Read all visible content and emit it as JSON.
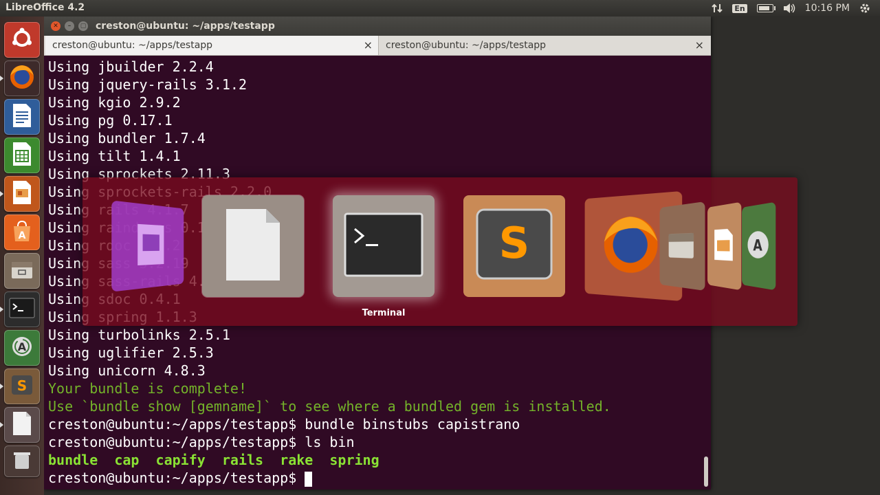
{
  "top_panel": {
    "app_title": "LibreOffice 4.2",
    "keyboard": "En",
    "clock": "10:16 PM"
  },
  "launcher": {
    "items": [
      {
        "icon": "ubuntu-dash-icon"
      },
      {
        "icon": "firefox-icon"
      },
      {
        "icon": "libreoffice-writer-icon"
      },
      {
        "icon": "libreoffice-calc-icon"
      },
      {
        "icon": "libreoffice-impress-icon"
      },
      {
        "icon": "ubuntu-software-center-icon"
      },
      {
        "icon": "files-icon"
      },
      {
        "icon": "terminal-icon"
      },
      {
        "icon": "software-updater-icon"
      },
      {
        "icon": "sublime-text-icon"
      },
      {
        "icon": "libreoffice-icon"
      },
      {
        "icon": "trash-icon"
      }
    ]
  },
  "window": {
    "title": "creston@ubuntu: ~/apps/testapp",
    "tabs": [
      {
        "label": "creston@ubuntu: ~/apps/testapp"
      },
      {
        "label": "creston@ubuntu: ~/apps/testapp"
      }
    ],
    "close_glyph": "×"
  },
  "terminal": {
    "lines": [
      {
        "text": "Using jbuilder 2.2.4",
        "style": "plain"
      },
      {
        "text": "Using jquery-rails 3.1.2",
        "style": "plain"
      },
      {
        "text": "Using kgio 2.9.2",
        "style": "plain"
      },
      {
        "text": "Using pg 0.17.1",
        "style": "plain"
      },
      {
        "text": "Using bundler 1.7.4",
        "style": "plain"
      },
      {
        "text": "Using tilt 1.4.1",
        "style": "plain"
      },
      {
        "text": "Using sprockets 2.11.3",
        "style": "plain"
      },
      {
        "text": "Using sprockets-rails 2.2.0",
        "style": "plain"
      },
      {
        "text": "Using rails 4.1.7",
        "style": "plain"
      },
      {
        "text": "Using raindrops 0.13.0",
        "style": "plain"
      },
      {
        "text": "Using rdoc 4.1.2",
        "style": "plain"
      },
      {
        "text": "Using sass 3.2.19",
        "style": "plain"
      },
      {
        "text": "Using sass-rails 4.0.4",
        "style": "plain"
      },
      {
        "text": "Using sdoc 0.4.1",
        "style": "plain"
      },
      {
        "text": "Using spring 1.1.3",
        "style": "plain"
      },
      {
        "text": "Using turbolinks 2.5.1",
        "style": "plain"
      },
      {
        "text": "Using uglifier 2.5.3",
        "style": "plain"
      },
      {
        "text": "Using unicorn 4.8.3",
        "style": "plain"
      },
      {
        "text": "Your bundle is complete!",
        "style": "green"
      },
      {
        "text": "Use `bundle show [gemname]` to see where a bundled gem is installed.",
        "style": "green"
      },
      {
        "text": "creston@ubuntu:~/apps/testapp$ bundle binstubs capistrano",
        "style": "plain"
      },
      {
        "text": "creston@ubuntu:~/apps/testapp$ ls bin",
        "style": "plain"
      },
      {
        "text": "bundle  cap  capify  rails  rake  spring",
        "style": "bold-green"
      },
      {
        "text": "creston@ubuntu:~/apps/testapp$ ",
        "style": "prompt"
      }
    ]
  },
  "switcher": {
    "selected_label": "Terminal",
    "items": [
      {
        "icon": "libreoffice-impress-icon"
      },
      {
        "icon": "libreoffice-icon"
      },
      {
        "icon": "terminal-icon"
      },
      {
        "icon": "sublime-text-icon"
      },
      {
        "icon": "firefox-icon"
      },
      {
        "icon": "files-icon"
      },
      {
        "icon": "libreoffice-impress-icon"
      },
      {
        "icon": "software-updater-icon"
      }
    ]
  },
  "colors": {
    "terminal_bg": "#300a24",
    "terminal_text": "#ffffff",
    "green_text": "#74b32a",
    "bold_green_text": "#8ae234",
    "switcher_bg": "#780a1e"
  }
}
